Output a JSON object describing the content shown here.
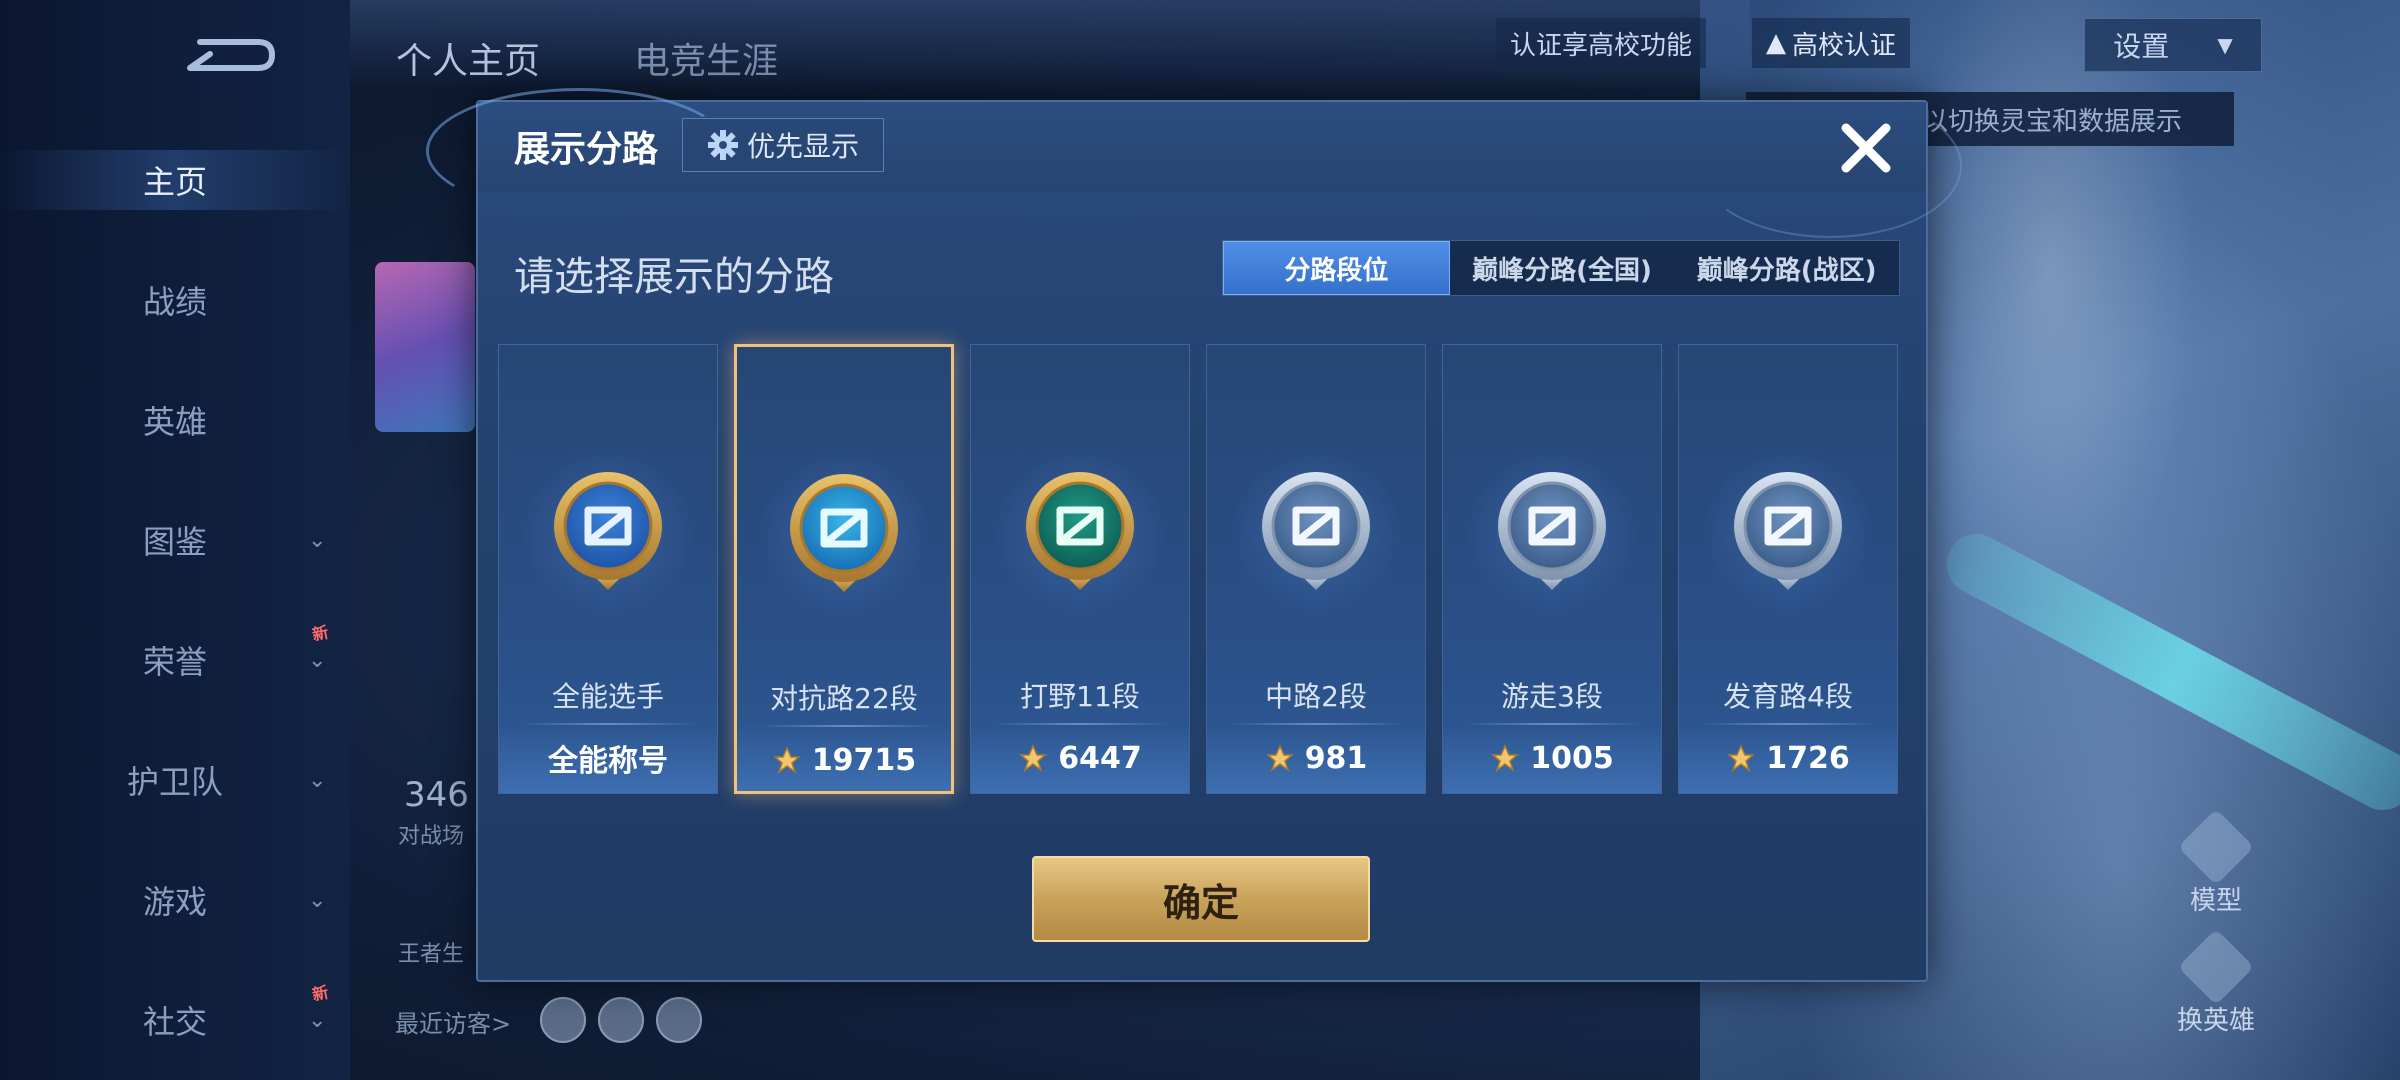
{
  "background": {
    "sidebar_items": [
      {
        "label": "主页",
        "active": true,
        "chevron": false,
        "new": false
      },
      {
        "label": "战绩",
        "active": false,
        "chevron": false,
        "new": false
      },
      {
        "label": "英雄",
        "active": false,
        "chevron": false,
        "new": false
      },
      {
        "label": "图鉴",
        "active": false,
        "chevron": true,
        "new": false
      },
      {
        "label": "荣誉",
        "active": false,
        "chevron": true,
        "new": true
      },
      {
        "label": "护卫队",
        "active": false,
        "chevron": true,
        "new": false
      },
      {
        "label": "游戏",
        "active": false,
        "chevron": true,
        "new": false
      },
      {
        "label": "社交",
        "active": false,
        "chevron": true,
        "new": true
      }
    ],
    "new_badge": "新",
    "top_tabs": [
      "个人主页",
      "电竞生涯"
    ],
    "verify_hint": "认证享高校功能",
    "campus_verify": "高校认证",
    "settings_label": "设置",
    "hint_text": "以切换灵宝和数据展示",
    "stat_value": "346",
    "stat_label": "对战场",
    "profile_label": "王者生",
    "recent_visitors": "最近访客>",
    "right_buttons": [
      "模型",
      "换英雄"
    ]
  },
  "modal": {
    "title": "展示分路",
    "priority_label": "优先显示",
    "subtitle": "请选择展示的分路",
    "tabs": [
      {
        "label": "分路段位",
        "active": true
      },
      {
        "label": "巅峰分路(全国)",
        "active": false
      },
      {
        "label": "巅峰分路(战区)",
        "active": false
      }
    ],
    "cards": [
      {
        "name": "全能选手",
        "score": "全能称号",
        "show_icon": false,
        "selected": false,
        "emblem": "gold-blue"
      },
      {
        "name": "对抗路22段",
        "score": "19715",
        "show_icon": true,
        "selected": true,
        "emblem": "gold-cyan"
      },
      {
        "name": "打野11段",
        "score": "6447",
        "show_icon": true,
        "selected": false,
        "emblem": "gold-green"
      },
      {
        "name": "中路2段",
        "score": "981",
        "show_icon": true,
        "selected": false,
        "emblem": "silver"
      },
      {
        "name": "游走3段",
        "score": "1005",
        "show_icon": true,
        "selected": false,
        "emblem": "silver"
      },
      {
        "name": "发育路4段",
        "score": "1726",
        "show_icon": true,
        "selected": false,
        "emblem": "silver"
      }
    ],
    "confirm_label": "确定"
  },
  "colors": {
    "gold": "#f2c27a",
    "tab_active": "#3f7fdc",
    "modal_bg": "#24426f"
  }
}
